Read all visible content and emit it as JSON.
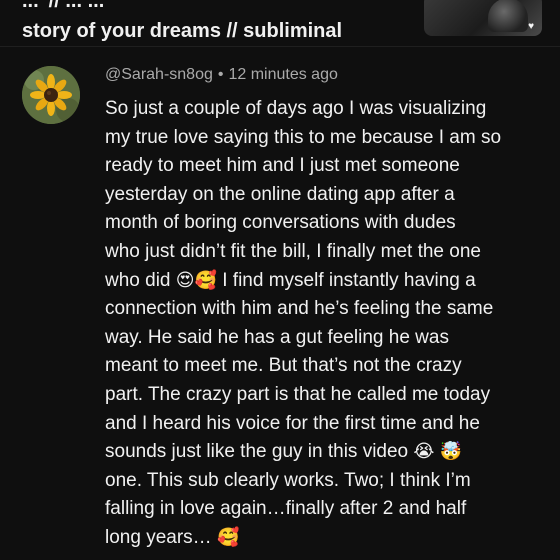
{
  "video": {
    "title_line_1": "...’ // ... ...",
    "title_line_2": "story of your dreams // subliminal"
  },
  "comment": {
    "author": "@Sarah-sn8og",
    "separator": "•",
    "time": "12 minutes ago",
    "lines": [
      "So just a couple of days ago I was visualizing",
      "my true love saying this to me because I am so",
      "ready to meet him and I just met someone",
      "yesterday on the online dating app after a",
      "month of boring conversations with dudes",
      "who just didn’t fit the bill, I finally met the one",
      "who did",
      "I find myself instantly having a",
      "connection with him and he’s feeling the same",
      "way. He said he has a gut feeling he was",
      "meant to meet me. But that’s not the crazy",
      "part. The crazy part is that he called me today",
      "and I heard his voice for the first time and he",
      "sounds just like the guy in this video",
      "one. This sub clearly works. Two; I think I’m",
      "falling in love again…finally after 2 and half",
      "long years…"
    ],
    "emoji": {
      "heart_eyes": "😍",
      "smiling_hearts": "🥰",
      "loud_crying": "😭",
      "exploding_head": "🤯",
      "smiling_hearts_end": "🥰"
    }
  },
  "icons": {
    "avatar": "sunflower-avatar-icon",
    "thumbnail_heart": "heart-icon"
  },
  "colors": {
    "background": "#0f0f0f",
    "text": "#f1f1f1",
    "meta": "#aaaaaa"
  }
}
